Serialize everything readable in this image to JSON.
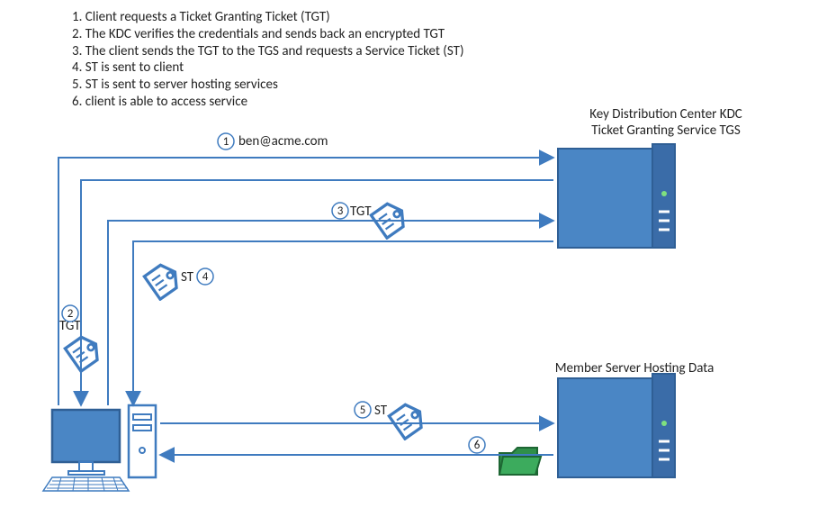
{
  "steps": [
    "1. Client requests a Ticket Granting Ticket (TGT)",
    "2. The KDC verifies the credentials and sends back an encrypted TGT",
    "3. The client sends the TGT to the TGS and requests a Service Ticket (ST)",
    "4. ST is sent to client",
    "5. ST is sent to server hosting services",
    "6. client is able to access service"
  ],
  "labels": {
    "kdc_line1": "Key Distribution Center KDC",
    "kdc_line2": "Ticket Granting Service TGS",
    "member_server": "Member Server Hosting Data",
    "user": "ben@acme.com",
    "tgt": "TGT",
    "st": "ST"
  },
  "markers": {
    "m1": "1",
    "m2": "2",
    "m3": "3",
    "m4": "4",
    "m5": "5",
    "m6": "6"
  },
  "colors": {
    "blue": "#3f7bbf",
    "blue_fill": "#4a86c5",
    "outline": "#2f5f95",
    "green": "#2f8f4a"
  }
}
